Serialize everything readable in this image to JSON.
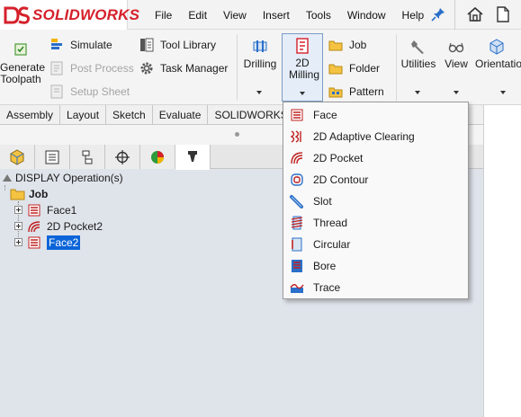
{
  "app": {
    "logo_text": "SOLIDWORKS"
  },
  "menu": [
    "File",
    "Edit",
    "View",
    "Insert",
    "Tools",
    "Window",
    "Help"
  ],
  "ribbon": {
    "generate_toolpath": "Generate Toolpath",
    "simulate": "Simulate",
    "post_process": "Post Process",
    "setup_sheet": "Setup Sheet",
    "tool_library": "Tool Library",
    "task_manager": "Task Manager",
    "drilling": "Drilling",
    "milling_2d": "2D Milling",
    "job": "Job",
    "folder": "Folder",
    "pattern": "Pattern",
    "utilities": "Utilities",
    "view": "View",
    "orientation": "Orientatio"
  },
  "tabs": [
    "Assembly",
    "Layout",
    "Sketch",
    "Evaluate",
    "SOLIDWORKS"
  ],
  "tree": {
    "root": "DISPLAY Operation(s)",
    "job": "Job",
    "items": [
      "Face1",
      "2D Pocket2",
      "Face2"
    ]
  },
  "dropdown": [
    "Face",
    "2D Adaptive Clearing",
    "2D Pocket",
    "2D Contour",
    "Slot",
    "Thread",
    "Circular",
    "Bore",
    "Trace"
  ],
  "colors": {
    "brand_red": "#d5202b",
    "selection_blue": "#0a64d8"
  }
}
